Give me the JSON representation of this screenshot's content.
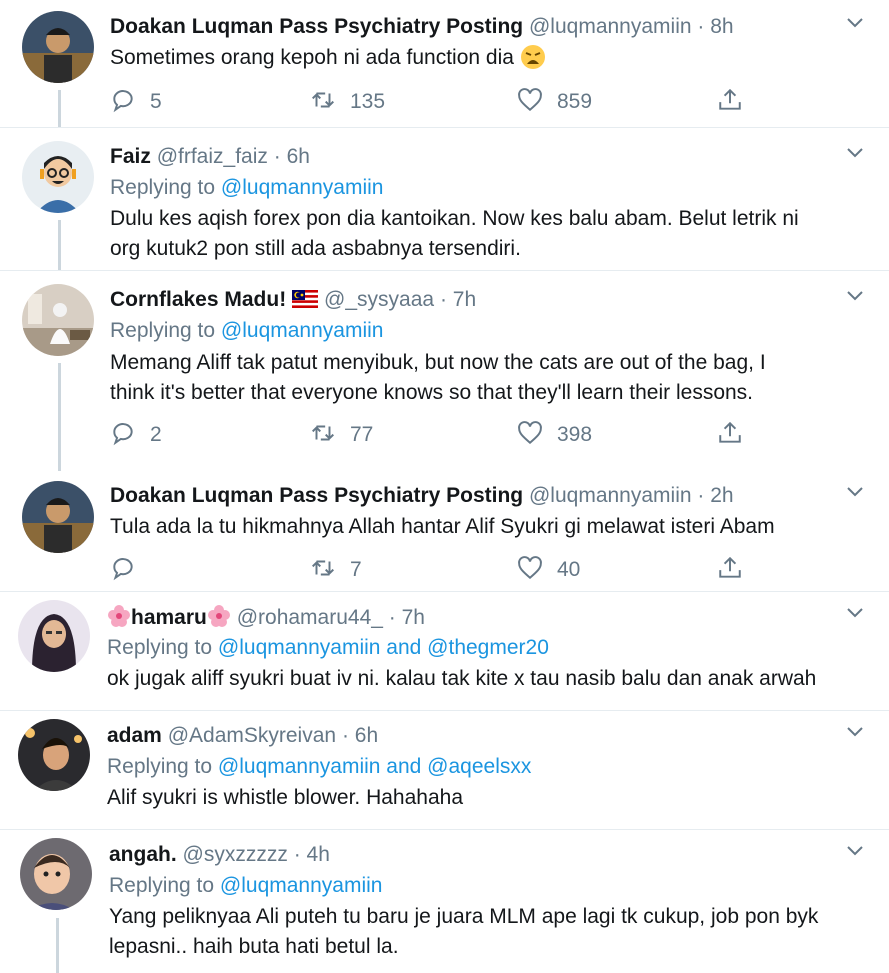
{
  "tweets": [
    {
      "name": "Doakan Luqman Pass Psychiatry Posting",
      "handle": "@luqmannyamiin",
      "time": "8h",
      "text": "Sometimes orang kepoh ni ada function dia",
      "emoji": "weary-face-emoji",
      "replies": "5",
      "retweets": "135",
      "likes": "859"
    },
    {
      "name": "Faiz",
      "handle": "@frfaiz_faiz",
      "time": "6h",
      "replying_label": "Replying to",
      "replying_to": "@luqmannyamiin",
      "text_lines": [
        "Dulu kes aqish forex pon dia kantoikan. Now kes balu abam. Belut letrik ni",
        "org kutuk2 pon still ada asbabnya tersendiri."
      ]
    },
    {
      "name": "Cornflakes Madu!",
      "flag": "malaysia-flag-emoji",
      "handle": "@_sysyaaa",
      "time": "7h",
      "replying_label": "Replying to",
      "replying_to": "@luqmannyamiin",
      "text_lines": [
        "Memang Aliff tak patut menyibuk, but now the cats are out of the bag, I",
        "think it's better that everyone knows so that they'll learn their lessons."
      ],
      "replies": "2",
      "retweets": "77",
      "likes": "398"
    },
    {
      "name": "Doakan Luqman Pass Psychiatry Posting",
      "handle": "@luqmannyamiin",
      "time": "2h",
      "text": "Tula ada la tu hikmahnya Allah hantar Alif Syukri gi melawat isteri Abam",
      "retweets": "7",
      "likes": "40"
    },
    {
      "name": "hamaru",
      "handle": "@rohamaru44_",
      "time": "7h",
      "replying_label": "Replying to",
      "replying_to": "@luqmannyamiin and @thegmer20",
      "text": "ok jugak aliff syukri buat iv ni. kalau tak kite x tau nasib balu dan anak arwah"
    },
    {
      "name": "adam",
      "handle": "@AdamSkyreivan",
      "time": "6h",
      "replying_label": "Replying to",
      "replying_to": "@luqmannyamiin and @aqeelsxx",
      "text": "Alif syukri is whistle blower. Hahahaha"
    },
    {
      "name": "angah.",
      "handle": "@syxzzzzz",
      "time": "4h",
      "replying_label": "Replying to",
      "replying_to": "@luqmannyamiin",
      "text_lines": [
        "Yang peliknyaa Ali puteh tu baru je juara MLM ape lagi tk cukup, job pon byk",
        "lepasni.. haih buta hati betul la."
      ]
    }
  ],
  "separator": "·",
  "colors": {
    "text": "#14171a",
    "secondary": "#657786",
    "link": "#1b95e0",
    "border": "#e6ecf0",
    "thread": "#ccd6dd"
  },
  "icons": [
    "reply-icon",
    "retweet-icon",
    "like-icon",
    "share-icon",
    "chevron-down-icon"
  ]
}
